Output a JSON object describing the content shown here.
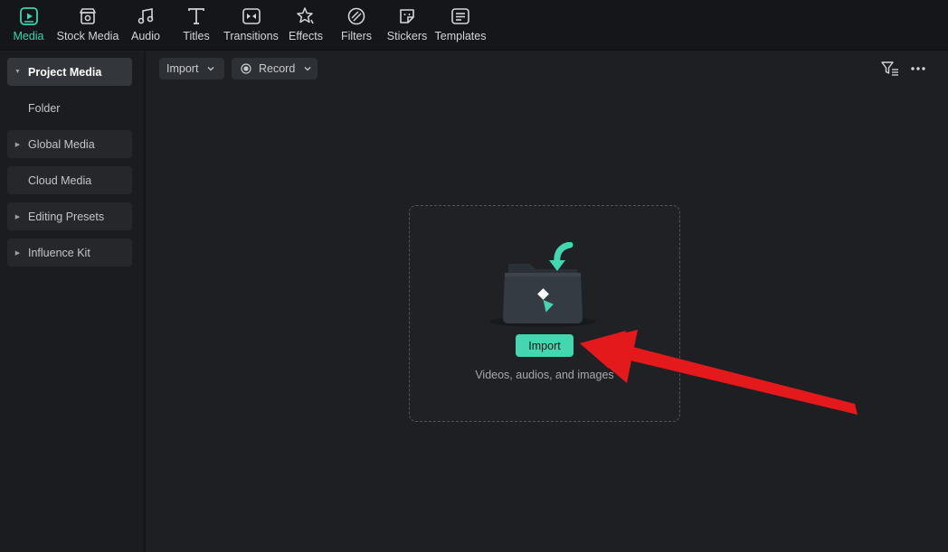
{
  "toolbar": {
    "tabs": [
      {
        "label": "Media",
        "icon": "media-icon",
        "active": true
      },
      {
        "label": "Stock Media",
        "icon": "stock-media-icon"
      },
      {
        "label": "Audio",
        "icon": "audio-icon"
      },
      {
        "label": "Titles",
        "icon": "titles-icon"
      },
      {
        "label": "Transitions",
        "icon": "transitions-icon"
      },
      {
        "label": "Effects",
        "icon": "effects-icon"
      },
      {
        "label": "Filters",
        "icon": "filters-icon"
      },
      {
        "label": "Stickers",
        "icon": "stickers-icon"
      },
      {
        "label": "Templates",
        "icon": "templates-icon"
      }
    ]
  },
  "sidebar": {
    "items": [
      {
        "label": "Project Media",
        "expandable": true,
        "active": true
      },
      {
        "label": "Folder",
        "expandable": false
      },
      {
        "label": "Global Media",
        "expandable": true
      },
      {
        "label": "Cloud Media",
        "expandable": false
      },
      {
        "label": "Editing Presets",
        "expandable": true
      },
      {
        "label": "Influence Kit",
        "expandable": true
      }
    ]
  },
  "main": {
    "import_dropdown": "Import",
    "record_dropdown": "Record",
    "dropzone": {
      "button_label": "Import",
      "hint": "Videos, audios, and images"
    }
  },
  "colors": {
    "accent": "#3fd2b2",
    "import_button": "#45d6b1",
    "annotation_arrow": "#e3191c"
  }
}
